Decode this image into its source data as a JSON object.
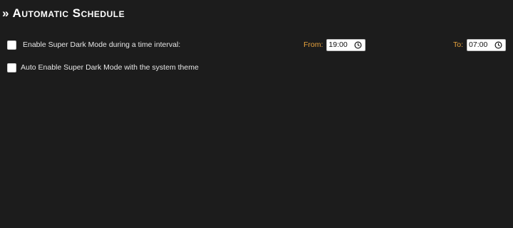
{
  "section": {
    "title": "» Automatic Schedule"
  },
  "options": {
    "interval": {
      "label": "Enable Super Dark Mode during a time interval:",
      "checked": false
    },
    "system_theme": {
      "label": "Auto Enable Super Dark Mode with the system theme",
      "checked": false
    }
  },
  "schedule": {
    "from_label": "From:",
    "from_value": "19:00",
    "to_label": "To:",
    "to_value": "07:00"
  },
  "colors": {
    "background": "#1c1c1c",
    "accent_label": "#e8a33d"
  },
  "icons": {
    "time_picker": "clock-icon"
  }
}
